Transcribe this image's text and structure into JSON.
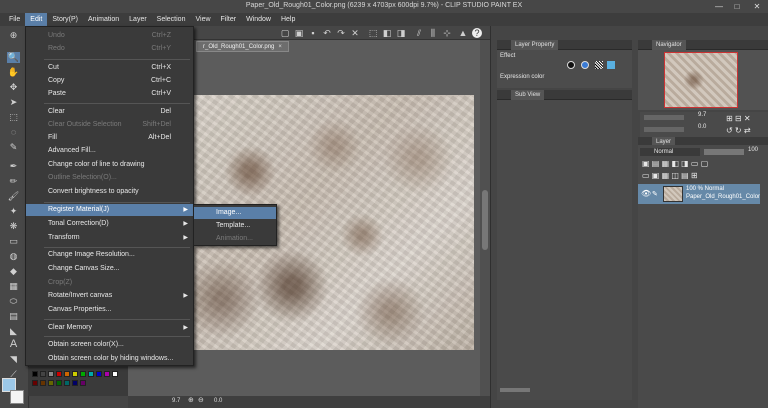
{
  "window": {
    "title": "Paper_Old_Rough01_Color.png (6239 x 4703px 600dpi 9.7%) - CLIP STUDIO PAINT EX",
    "minimize": "—",
    "maximize": "□",
    "close": "✕"
  },
  "menubar": [
    "File",
    "Edit",
    "Story(P)",
    "Animation",
    "Layer",
    "Selection",
    "View",
    "Filter",
    "Window",
    "Help"
  ],
  "edit_menu": {
    "undo": {
      "label": "Undo",
      "shortcut": "Ctrl+Z"
    },
    "redo": {
      "label": "Redo",
      "shortcut": "Ctrl+Y"
    },
    "cut": {
      "label": "Cut",
      "shortcut": "Ctrl+X"
    },
    "copy": {
      "label": "Copy",
      "shortcut": "Ctrl+C"
    },
    "paste": {
      "label": "Paste",
      "shortcut": "Ctrl+V"
    },
    "clear": {
      "label": "Clear",
      "shortcut": "Del"
    },
    "clear_outside": {
      "label": "Clear Outside Selection",
      "shortcut": "Shift+Del"
    },
    "fill": {
      "label": "Fill",
      "shortcut": "Alt+Del"
    },
    "advanced_fill": {
      "label": "Advanced Fill..."
    },
    "change_line_color": {
      "label": "Change color of line to drawing"
    },
    "outline_selection": {
      "label": "Outline Selection(O)..."
    },
    "brightness_opacity": {
      "label": "Convert brightness to opacity"
    },
    "register_material": {
      "label": "Register Material(J)",
      "arrow": "▶"
    },
    "tonal_correction": {
      "label": "Tonal Correction(D)",
      "arrow": "▶"
    },
    "transform": {
      "label": "Transform",
      "arrow": "▶"
    },
    "change_resolution": {
      "label": "Change Image Resolution..."
    },
    "change_canvas_size": {
      "label": "Change Canvas Size..."
    },
    "crop": {
      "label": "Crop(Z)"
    },
    "rotate_invert": {
      "label": "Rotate/Invert canvas",
      "arrow": "▶"
    },
    "canvas_properties": {
      "label": "Canvas Properties..."
    },
    "clear_memory": {
      "label": "Clear Memory",
      "arrow": "▶"
    },
    "obtain_screen_color": {
      "label": "Obtain screen color(X)..."
    },
    "obtain_screen_color_hiding": {
      "label": "Obtain screen color by hiding windows..."
    }
  },
  "submenu": {
    "image": "Image...",
    "template": "Template...",
    "animation": "Animation..."
  },
  "document_tab": {
    "label": "r_Old_Rough01_Color.png",
    "close": "×"
  },
  "panels": {
    "layer_property": "Layer Property",
    "effect": "Effect",
    "expression_color": "Expression color",
    "sub_view": "Sub View",
    "navigator": "Navigator",
    "layer": "Layer",
    "blend_mode": "Normal",
    "opacity": "100",
    "nav_zoom": "9.7",
    "nav_angle": "0.0"
  },
  "layer_item": {
    "line1": "100 % Normal",
    "line2": "Paper_Old_Rough01_Color"
  },
  "status": {
    "zoom": "9.7",
    "angle": "0.0"
  }
}
